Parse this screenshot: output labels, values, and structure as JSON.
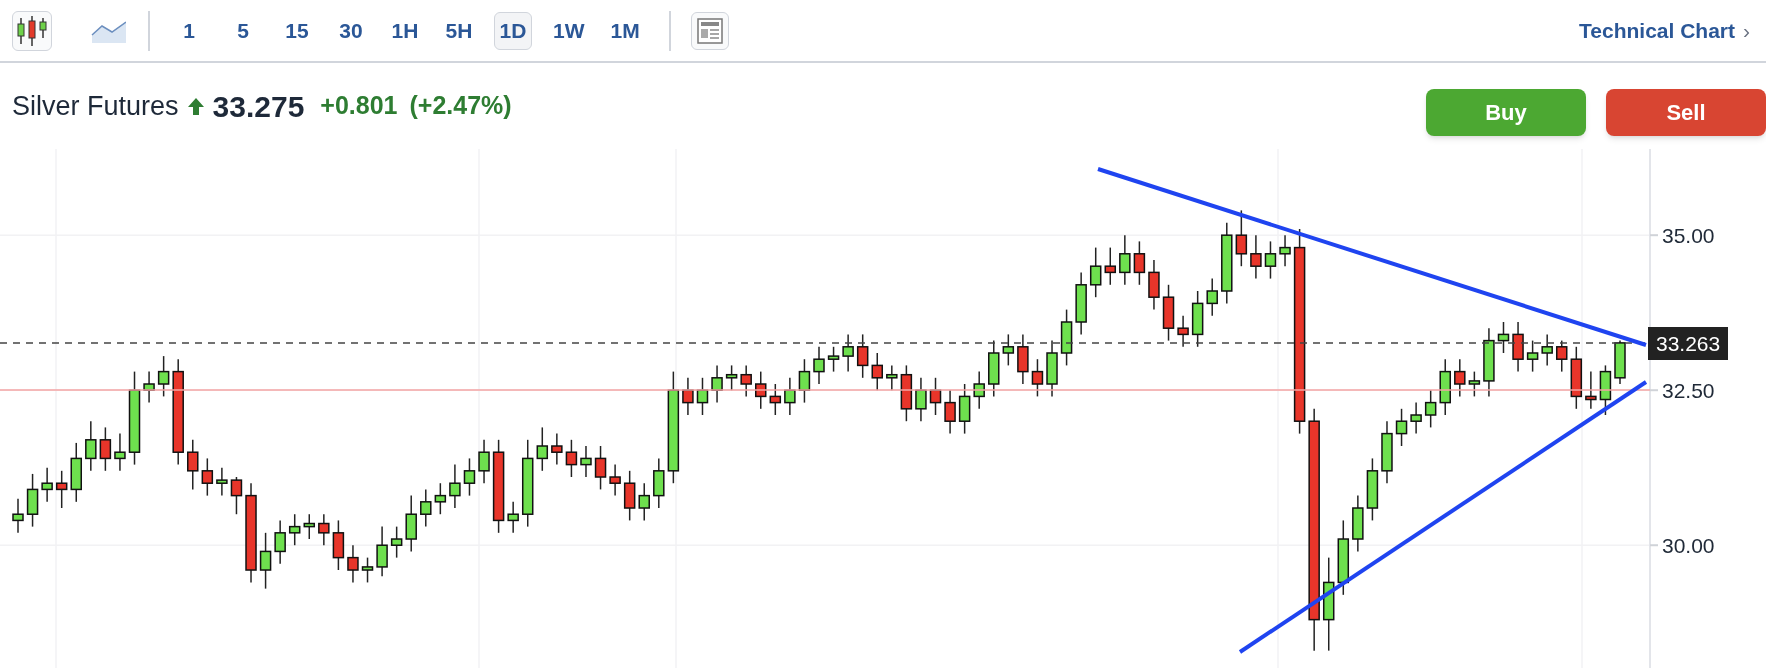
{
  "toolbar": {
    "chart_types": [
      {
        "kind": "candlestick",
        "selected": true
      },
      {
        "kind": "line",
        "selected": false
      }
    ],
    "intervals": [
      {
        "label": "1",
        "selected": false
      },
      {
        "label": "5",
        "selected": false
      },
      {
        "label": "15",
        "selected": false
      },
      {
        "label": "30",
        "selected": false
      },
      {
        "label": "1H",
        "selected": false
      },
      {
        "label": "5H",
        "selected": false
      },
      {
        "label": "1D",
        "selected": true
      },
      {
        "label": "1W",
        "selected": false
      },
      {
        "label": "1M",
        "selected": false
      }
    ],
    "link": {
      "label": "Technical Chart",
      "chevron": "›"
    }
  },
  "instrument": {
    "name": "Silver Futures",
    "positive": true,
    "price": "33.275",
    "change": "+0.801",
    "change_percent": "(+2.47%)"
  },
  "buttons": [
    {
      "kind": "buy",
      "label": "Buy"
    },
    {
      "kind": "sell",
      "label": "Sell"
    }
  ],
  "chart": {
    "last_price": "33.263",
    "chart_data": {
      "type": "candlestick",
      "ylim": [
        28.02,
        36.39
      ],
      "yticks": [
        {
          "value": 35,
          "label": "35.00"
        },
        {
          "value": 32.5,
          "label": "32.50"
        },
        {
          "value": 30,
          "label": "30.00"
        }
      ],
      "ohlc": [
        [
          30.4,
          30.75,
          30.2,
          30.5
        ],
        [
          30.5,
          31.15,
          30.3,
          30.9
        ],
        [
          30.9,
          31.25,
          30.7,
          31.0
        ],
        [
          31.0,
          31.2,
          30.6,
          30.9
        ],
        [
          30.9,
          31.65,
          30.7,
          31.4
        ],
        [
          31.4,
          32.0,
          31.2,
          31.7
        ],
        [
          31.7,
          31.9,
          31.2,
          31.4
        ],
        [
          31.4,
          31.8,
          31.2,
          31.5
        ],
        [
          31.5,
          32.8,
          31.3,
          32.5
        ],
        [
          32.5,
          32.8,
          32.3,
          32.6
        ],
        [
          32.6,
          33.05,
          32.4,
          32.8
        ],
        [
          32.8,
          33.0,
          31.3,
          31.5
        ],
        [
          31.5,
          31.7,
          30.9,
          31.2
        ],
        [
          31.2,
          31.4,
          30.8,
          31.0
        ],
        [
          31.0,
          31.25,
          30.8,
          31.05
        ],
        [
          31.05,
          31.1,
          30.5,
          30.8
        ],
        [
          30.8,
          31.0,
          29.4,
          29.6
        ],
        [
          29.6,
          30.2,
          29.3,
          29.9
        ],
        [
          29.9,
          30.4,
          29.7,
          30.2
        ],
        [
          30.2,
          30.5,
          30.0,
          30.3
        ],
        [
          30.3,
          30.5,
          30.1,
          30.35
        ],
        [
          30.35,
          30.5,
          30.0,
          30.2
        ],
        [
          30.2,
          30.4,
          29.6,
          29.8
        ],
        [
          29.8,
          30.0,
          29.4,
          29.6
        ],
        [
          29.6,
          29.8,
          29.4,
          29.65
        ],
        [
          29.65,
          30.3,
          29.5,
          30.0
        ],
        [
          30.0,
          30.3,
          29.8,
          30.1
        ],
        [
          30.1,
          30.8,
          29.9,
          30.5
        ],
        [
          30.5,
          30.9,
          30.3,
          30.7
        ],
        [
          30.7,
          31.0,
          30.5,
          30.8
        ],
        [
          30.8,
          31.3,
          30.6,
          31.0
        ],
        [
          31.0,
          31.4,
          30.8,
          31.2
        ],
        [
          31.2,
          31.7,
          31.0,
          31.5
        ],
        [
          31.5,
          31.7,
          30.2,
          30.4
        ],
        [
          30.4,
          30.7,
          30.2,
          30.5
        ],
        [
          30.5,
          31.7,
          30.3,
          31.4
        ],
        [
          31.4,
          31.9,
          31.2,
          31.6
        ],
        [
          31.6,
          31.8,
          31.3,
          31.5
        ],
        [
          31.5,
          31.7,
          31.1,
          31.3
        ],
        [
          31.3,
          31.6,
          31.1,
          31.4
        ],
        [
          31.4,
          31.6,
          30.9,
          31.1
        ],
        [
          31.1,
          31.3,
          30.8,
          31.0
        ],
        [
          31.0,
          31.2,
          30.4,
          30.6
        ],
        [
          30.6,
          31.0,
          30.4,
          30.8
        ],
        [
          30.8,
          31.4,
          30.6,
          31.2
        ],
        [
          31.2,
          32.8,
          31.0,
          32.5
        ],
        [
          32.5,
          32.7,
          32.1,
          32.3
        ],
        [
          32.3,
          32.7,
          32.1,
          32.5
        ],
        [
          32.5,
          32.9,
          32.3,
          32.7
        ],
        [
          32.7,
          32.9,
          32.5,
          32.75
        ],
        [
          32.75,
          32.9,
          32.4,
          32.6
        ],
        [
          32.6,
          32.8,
          32.2,
          32.4
        ],
        [
          32.4,
          32.6,
          32.1,
          32.3
        ],
        [
          32.3,
          32.7,
          32.1,
          32.5
        ],
        [
          32.5,
          33.0,
          32.3,
          32.8
        ],
        [
          32.8,
          33.2,
          32.6,
          33.0
        ],
        [
          33.0,
          33.2,
          32.8,
          33.05
        ],
        [
          33.05,
          33.4,
          32.8,
          33.2
        ],
        [
          33.2,
          33.4,
          32.7,
          32.9
        ],
        [
          32.9,
          33.1,
          32.5,
          32.7
        ],
        [
          32.7,
          32.9,
          32.5,
          32.75
        ],
        [
          32.75,
          32.9,
          32.0,
          32.2
        ],
        [
          32.2,
          32.7,
          32.0,
          32.5
        ],
        [
          32.5,
          32.7,
          32.1,
          32.3
        ],
        [
          32.3,
          32.5,
          31.8,
          32.0
        ],
        [
          32.0,
          32.6,
          31.8,
          32.4
        ],
        [
          32.4,
          32.8,
          32.2,
          32.6
        ],
        [
          32.6,
          33.3,
          32.4,
          33.1
        ],
        [
          33.1,
          33.4,
          32.9,
          33.2
        ],
        [
          33.2,
          33.4,
          32.6,
          32.8
        ],
        [
          32.8,
          33.0,
          32.4,
          32.6
        ],
        [
          32.6,
          33.3,
          32.4,
          33.1
        ],
        [
          33.1,
          33.8,
          32.9,
          33.6
        ],
        [
          33.6,
          34.4,
          33.4,
          34.2
        ],
        [
          34.2,
          34.8,
          34.0,
          34.5
        ],
        [
          34.5,
          34.8,
          34.2,
          34.4
        ],
        [
          34.4,
          35.0,
          34.2,
          34.7
        ],
        [
          34.7,
          34.9,
          34.2,
          34.4
        ],
        [
          34.4,
          34.6,
          33.8,
          34.0
        ],
        [
          34.0,
          34.2,
          33.3,
          33.5
        ],
        [
          33.5,
          33.7,
          33.2,
          33.4
        ],
        [
          33.4,
          34.1,
          33.2,
          33.9
        ],
        [
          33.9,
          34.3,
          33.7,
          34.1
        ],
        [
          34.1,
          35.2,
          33.9,
          35.0
        ],
        [
          35.0,
          35.4,
          34.5,
          34.7
        ],
        [
          34.7,
          35.0,
          34.3,
          34.5
        ],
        [
          34.5,
          34.9,
          34.3,
          34.7
        ],
        [
          34.7,
          35.0,
          34.5,
          34.8
        ],
        [
          34.8,
          35.1,
          31.8,
          32.0
        ],
        [
          32.0,
          32.2,
          28.3,
          28.8
        ],
        [
          28.8,
          29.8,
          28.3,
          29.4
        ],
        [
          29.4,
          30.4,
          29.2,
          30.1
        ],
        [
          30.1,
          30.8,
          29.9,
          30.6
        ],
        [
          30.6,
          31.4,
          30.4,
          31.2
        ],
        [
          31.2,
          32.0,
          31.0,
          31.8
        ],
        [
          31.8,
          32.2,
          31.6,
          32.0
        ],
        [
          32.0,
          32.3,
          31.8,
          32.1
        ],
        [
          32.1,
          32.5,
          31.9,
          32.3
        ],
        [
          32.3,
          33.0,
          32.1,
          32.8
        ],
        [
          32.8,
          33.0,
          32.4,
          32.6
        ],
        [
          32.6,
          32.8,
          32.4,
          32.65
        ],
        [
          32.65,
          33.5,
          32.4,
          33.3
        ],
        [
          33.3,
          33.6,
          33.1,
          33.4
        ],
        [
          33.4,
          33.6,
          32.8,
          33.0
        ],
        [
          33.0,
          33.3,
          32.8,
          33.1
        ],
        [
          33.1,
          33.4,
          32.9,
          33.2
        ],
        [
          33.2,
          33.3,
          32.8,
          33.0
        ],
        [
          33.0,
          33.2,
          32.2,
          32.4
        ],
        [
          32.4,
          32.8,
          32.2,
          32.35
        ],
        [
          32.35,
          32.9,
          32.1,
          32.8
        ],
        [
          32.7,
          33.3,
          32.6,
          33.263
        ]
      ]
    }
  }
}
